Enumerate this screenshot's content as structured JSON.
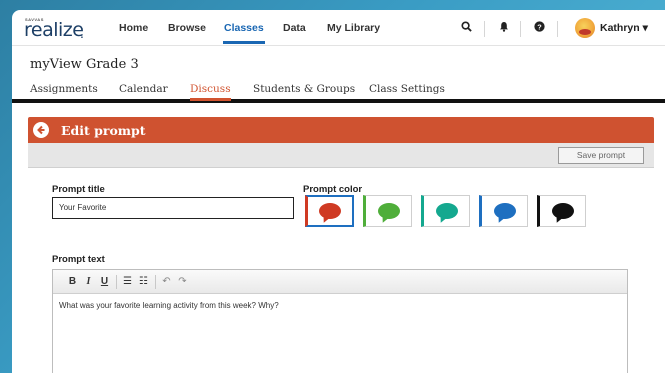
{
  "app": {
    "logo_small": "SAVVAS",
    "logo_main": "realize",
    "logo_dot": "."
  },
  "nav": {
    "items": [
      {
        "label": "Home"
      },
      {
        "label": "Browse"
      },
      {
        "label": "Classes"
      },
      {
        "label": "Data"
      },
      {
        "label": "My Library"
      }
    ],
    "active": "Classes",
    "user_name": "Kathryn ▾"
  },
  "class": {
    "title": "myView Grade 3",
    "tabs": [
      {
        "label": "Assignments"
      },
      {
        "label": "Calendar"
      },
      {
        "label": "Discuss"
      },
      {
        "label": "Students & Groups"
      },
      {
        "label": "Class Settings"
      }
    ],
    "active_tab": "Discuss"
  },
  "modal": {
    "title": "Edit prompt",
    "save_label": "Save prompt",
    "prompt_title_label": "Prompt title",
    "prompt_title_value": "Your Favorite",
    "prompt_color_label": "Prompt color",
    "prompt_text_label": "Prompt text",
    "prompt_text_value": "What was your favorite learning activity from this week?  Why?",
    "colors": [
      {
        "name": "red",
        "hex": "#cf3a23"
      },
      {
        "name": "green",
        "hex": "#4fae3a"
      },
      {
        "name": "teal",
        "hex": "#14a88f"
      },
      {
        "name": "blue",
        "hex": "#1e6fc0"
      },
      {
        "name": "black",
        "hex": "#111111"
      }
    ],
    "toolbar": {
      "bold": "B",
      "italic": "I",
      "underline": "U",
      "bullets": "☰",
      "numbered": "☷",
      "undo": "↶",
      "redo": "↷"
    }
  }
}
